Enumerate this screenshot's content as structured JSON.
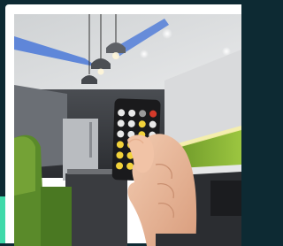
{
  "photo": {
    "subject": "hand-holding-ir-remote-in-kitchen",
    "remote_button_colors": [
      "#e9e9e9",
      "#f2d23a",
      "#d53a2a",
      "#9a9a9a"
    ],
    "accent_color": "#3fd9a9",
    "frame_color": "#0d2a33"
  }
}
